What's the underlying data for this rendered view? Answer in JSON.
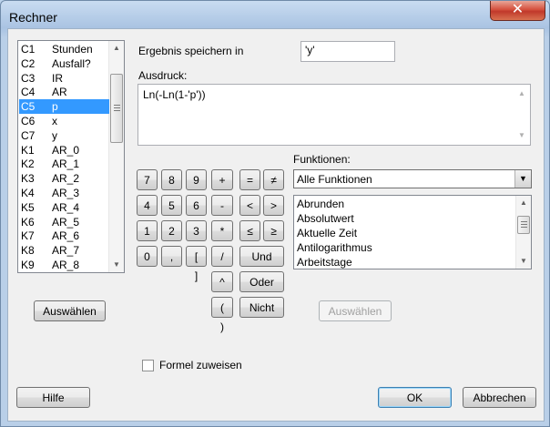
{
  "window": {
    "title": "Rechner",
    "close_glyph": "✕"
  },
  "columns": [
    {
      "id": "C1",
      "name": "Stunden"
    },
    {
      "id": "C2",
      "name": "Ausfall?"
    },
    {
      "id": "C3",
      "name": "IR"
    },
    {
      "id": "C4",
      "name": "AR"
    },
    {
      "id": "C5",
      "name": "p",
      "selected": true
    },
    {
      "id": "C6",
      "name": "x"
    },
    {
      "id": "C7",
      "name": "y"
    },
    {
      "id": "K1",
      "name": "AR_0"
    },
    {
      "id": "K2",
      "name": "AR_1"
    },
    {
      "id": "K3",
      "name": "AR_2"
    },
    {
      "id": "K4",
      "name": "AR_3"
    },
    {
      "id": "K5",
      "name": "AR_4"
    },
    {
      "id": "K6",
      "name": "AR_5"
    },
    {
      "id": "K7",
      "name": "AR_6"
    },
    {
      "id": "K8",
      "name": "AR_7"
    },
    {
      "id": "K9",
      "name": "AR_8"
    }
  ],
  "store_label": "Ergebnis speichern in",
  "store_value": "'y'",
  "expression_label": "Ausdruck:",
  "expression_value": "Ln(-Ln(1-'p'))",
  "functions_label": "Funktionen:",
  "functions_selected": "Alle Funktionen",
  "functions_list": [
    "Abrunden",
    "Absolutwert",
    "Aktuelle Zeit",
    "Antilogarithmus",
    "Arbeitstage"
  ],
  "keypad": {
    "k7": "7",
    "k8": "8",
    "k9": "9",
    "plus": "+",
    "eq": "=",
    "neq": "≠",
    "k4": "4",
    "k5": "5",
    "k6": "6",
    "minus": "-",
    "lt": "<",
    "gt": ">",
    "k1": "1",
    "k2": "2",
    "k3": "3",
    "mul": "*",
    "le": "≤",
    "ge": "≥",
    "k0": "0",
    "comma": ",",
    "brackets": "[ ]",
    "div": "/",
    "and": "Und",
    "pow": "^",
    "or": "Oder",
    "parens": "( )",
    "not": "Nicht"
  },
  "select_left": "Auswählen",
  "select_right": "Auswählen",
  "assign_formula": "Formel zuweisen",
  "help": "Hilfe",
  "ok": "OK",
  "cancel": "Abbrechen",
  "colors": {
    "selection": "#3399ff",
    "title_bg": "#a9c3e2",
    "close_bg": "#c0392b"
  }
}
